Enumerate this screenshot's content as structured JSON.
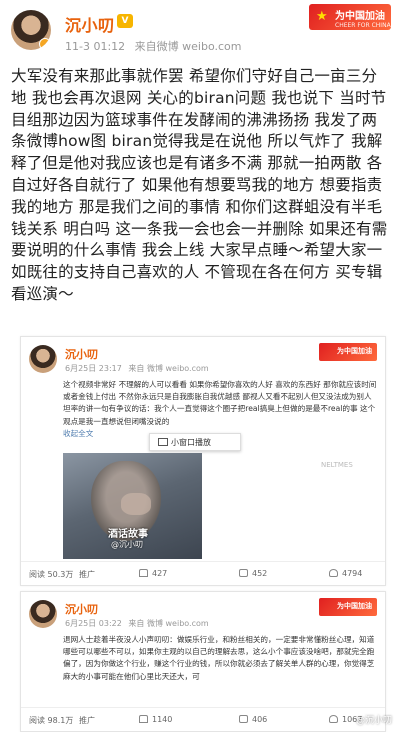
{
  "post": {
    "author": "沉小叨",
    "vip_badge": "V",
    "time": "11-3 01:12",
    "source": "来自微博 weibo.com",
    "flag_badge": {
      "main": "为中国加油",
      "sub": "CHEER FOR CHINA"
    },
    "text": "大军没有来那此事就作罢 希望你们守好自己一亩三分地 我也会再次退网 关心的biran问题 我也说下 当时节目组那边因为篮球事件在发酵闹的沸沸扬扬 我发了两条微博how图 biran觉得我是在说他 所以气炸了 我解释了但是他对我应该也是有诸多不满 那就一拍两散 各自过好各自就行了 如果他有想要骂我的地方 想要指责我的地方 那是我们之间的事情 和你们这群蛆没有半毛钱关系 明白吗 这一条我一会也会一并删除 如果还有需要说明的什么事情 我会上线 大家早点睡～希望大家一如既往的支持自己喜欢的人 不管现在各在何方 买专辑看巡演～"
  },
  "embed1": {
    "author": "沉小叨",
    "time": "6月25日 23:17",
    "source": "来自 微博 weibo.com",
    "flag_badge": "为中国加油",
    "text": "这个视频非常好 不理解的人可以看看 如果你希望你喜欢的人好 喜欢的东西好 那你就应该时间或者金钱上付出 不然你永远只是自我膨胀自我优越感 鄙视人又看不起别人但又没法成为别人 坦率的讲一句有争议的话：我个人一直觉得这个圈子把real搞臭上但做的是最不real的事 这个观点是我一直想说但闭嘴没说的",
    "collapse": "收起全文",
    "popup": "小窗口播放",
    "video_title": "酒话故事",
    "video_handle": "@沉小叨",
    "video_site": "NELTMES",
    "reads": "阅读 50.3万",
    "promote": "推广",
    "shares": "427",
    "comments": "452",
    "likes": "4794"
  },
  "embed2": {
    "author": "沉小叨",
    "time": "6月25日 03:22",
    "source": "来自 微博 weibo.com",
    "flag_badge": "为中国加油",
    "text": "退网人士趁着半夜没人小声叨叨：做娱乐行业，和粉丝相关的，一定要非常懂粉丝心理，知道哪些可以哪些不可以，如果你主观的以自己的理解去思，这么小个事应该没啥吧，那就完全跑偏了，因为你做这个行业，赚这个行业的钱，所以你就必须去了解关单人群的心理，你觉得芝麻大的小事可能在他们心里比天还大，可",
    "reads": "阅读 98.1万",
    "promote": "推广",
    "shares": "1140",
    "comments": "406",
    "likes": "1067"
  },
  "watermark": "@沉小叨",
  "colors": {
    "name": "#e8620d",
    "link": "#507daf",
    "badge": "#e02020"
  }
}
